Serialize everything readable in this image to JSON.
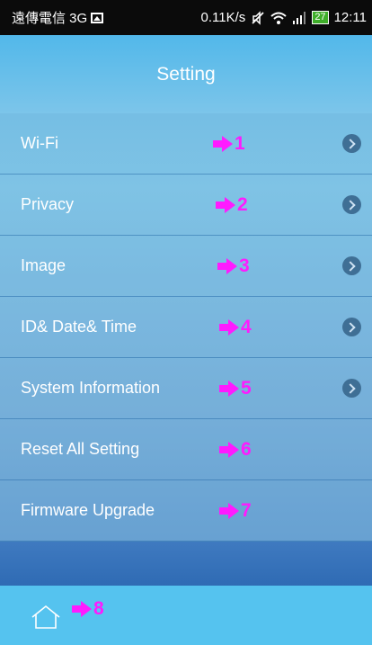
{
  "status_bar": {
    "carrier": "遠傳電信 3G",
    "speed": "0.11K/s",
    "battery": "27",
    "time": "12:11"
  },
  "header": {
    "title": "Setting"
  },
  "menu": {
    "items": [
      {
        "label": "Wi-Fi",
        "marker": "1",
        "has_chevron": true
      },
      {
        "label": "Privacy",
        "marker": "2",
        "has_chevron": true
      },
      {
        "label": "Image",
        "marker": "3",
        "has_chevron": true
      },
      {
        "label": "ID& Date& Time",
        "marker": "4",
        "has_chevron": true
      },
      {
        "label": "System Information",
        "marker": "5",
        "has_chevron": true
      },
      {
        "label": "Reset All Setting",
        "marker": "6",
        "has_chevron": false
      },
      {
        "label": "Firmware Upgrade",
        "marker": "7",
        "has_chevron": false
      }
    ]
  },
  "footer": {
    "home_marker": "8"
  },
  "colors": {
    "marker": "#ff1aff",
    "header": "#52b8ea",
    "footer": "#55c3ef"
  }
}
